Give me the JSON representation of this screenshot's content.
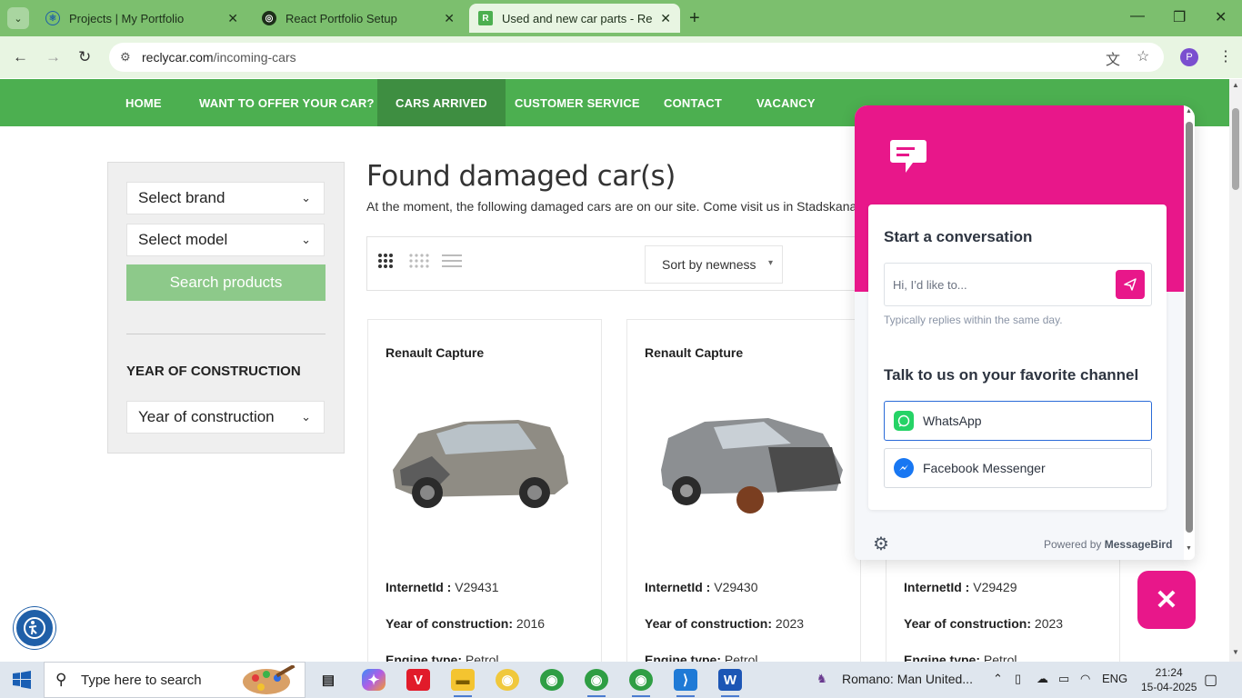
{
  "browser": {
    "tabs": [
      {
        "title": "Projects | My Portfolio",
        "active": false
      },
      {
        "title": "React Portfolio Setup",
        "active": false
      },
      {
        "title": "Used and new car parts - Reclyc",
        "active": true
      }
    ],
    "url_host": "reclycar.com",
    "url_path": "/incoming-cars",
    "profile_initial": "P"
  },
  "site": {
    "nav": [
      {
        "label": "HOME",
        "active": false
      },
      {
        "label": "WANT TO OFFER YOUR CAR?",
        "active": false
      },
      {
        "label": "CARS ARRIVED",
        "active": true
      },
      {
        "label": "CUSTOMER SERVICE",
        "active": false
      },
      {
        "label": "CONTACT",
        "active": false
      },
      {
        "label": "VACANCY",
        "active": false
      }
    ],
    "filters": {
      "brand": "Select brand",
      "model": "Select model",
      "search_label": "Search products",
      "year_heading": "YEAR OF CONSTRUCTION",
      "year": "Year of construction"
    },
    "heading": "Found damaged car(s)",
    "intro": "At the moment, the following damaged cars are on our site. Come visit us in Stadskanaa",
    "sort": "Sort by newness",
    "labels": {
      "internet_id": "InternetId :",
      "year": "Year of construction:",
      "engine": "Engine type:"
    },
    "cards": [
      {
        "name": "Renault Capture",
        "internet_id": "V29431",
        "year": "2016",
        "engine": "Petrol"
      },
      {
        "name": "Renault Capture",
        "internet_id": "V29430",
        "year": "2023",
        "engine": "Petrol"
      },
      {
        "name": "",
        "internet_id": "V29429",
        "year": "2023",
        "engine": "Petrol"
      }
    ]
  },
  "chat": {
    "start_title": "Start a conversation",
    "input_placeholder": "Hi, I’d like to...",
    "replies": "Typically replies within the same day.",
    "channels_title": "Talk to us on your favorite channel",
    "channels": [
      "WhatsApp",
      "Facebook Messenger"
    ],
    "powered_prefix": "Powered by",
    "powered_brand": "MessageBird",
    "accent": "#e8178a"
  },
  "taskbar": {
    "search_placeholder": "Type here to search",
    "news": "Romano: Man United...",
    "lang": "ENG",
    "time": "21:24",
    "date": "15-04-2025"
  },
  "colors": {
    "site_green": "#4caf50",
    "tab_green": "#7cbf6e",
    "pink": "#e8178a"
  }
}
